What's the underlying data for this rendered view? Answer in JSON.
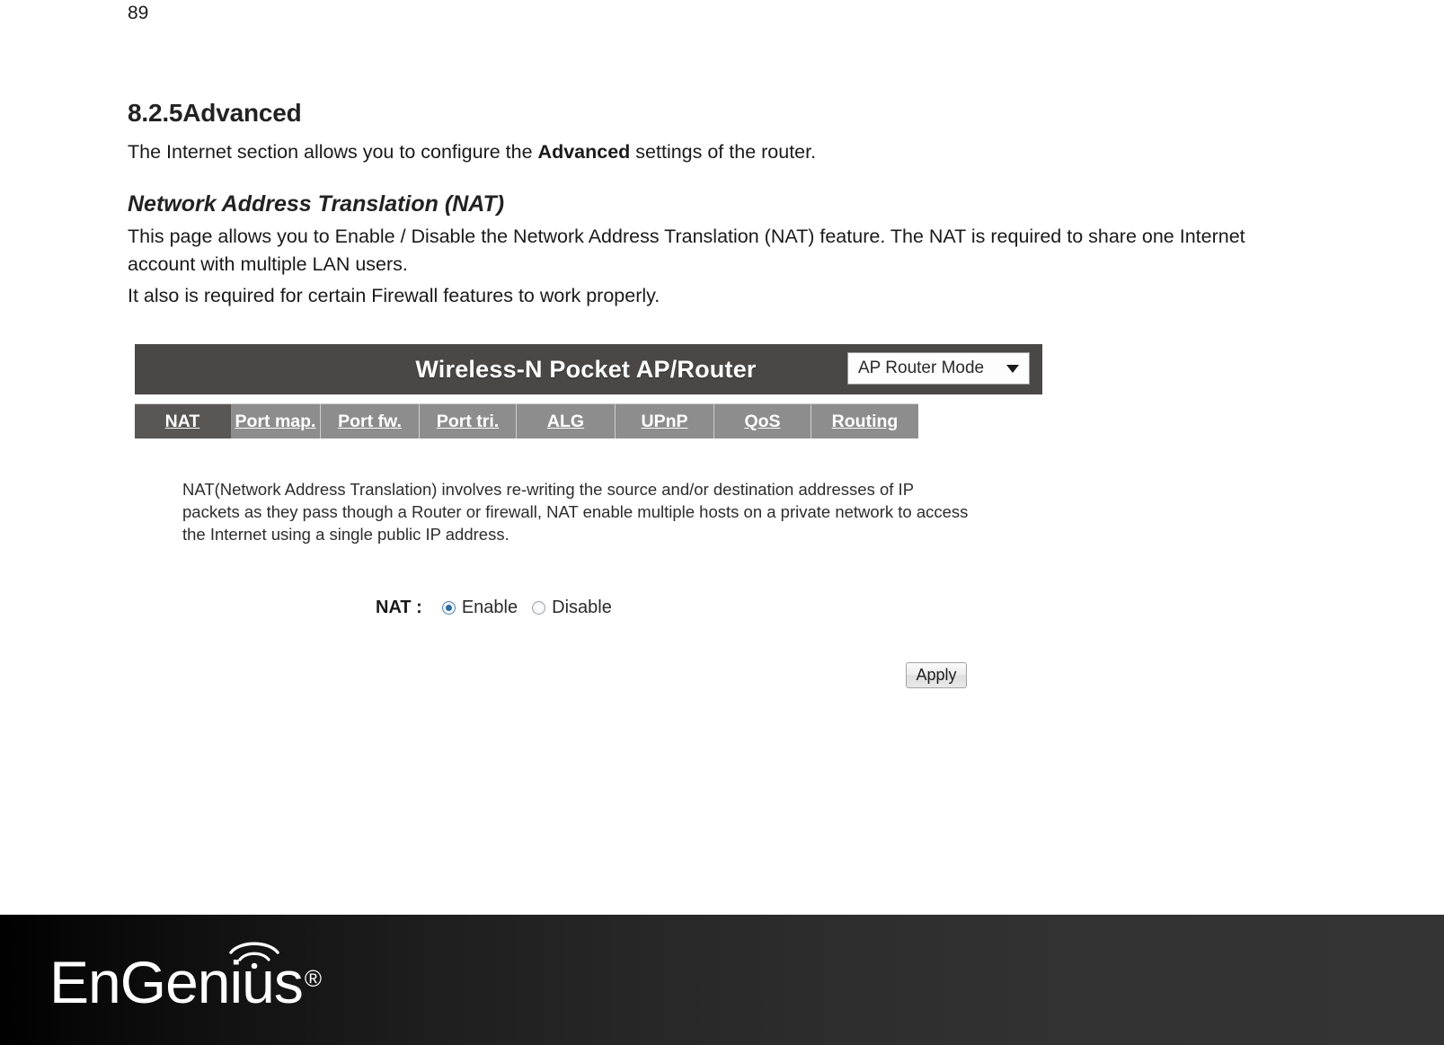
{
  "page": {
    "number": "89"
  },
  "document": {
    "section_heading": "8.2.5Advanced",
    "intro_before_bold": "The Internet section allows you to configure the ",
    "intro_bold": "Advanced",
    "intro_after_bold": " settings of the router.",
    "sub_heading": "Network Address Translation (NAT)",
    "paragraph_1": "This page allows you to Enable / Disable the Network Address Translation (NAT) feature. The NAT is required to share one Internet account with multiple LAN users.",
    "paragraph_2": "It also is required for certain Firewall features to work properly."
  },
  "router_ui": {
    "title": "Wireless-N Pocket AP/Router",
    "mode_select": {
      "value": "AP Router Mode",
      "caret_icon": "chevron-down-icon"
    },
    "tabs": [
      {
        "label": "NAT",
        "active": true
      },
      {
        "label": "Port map.",
        "active": false
      },
      {
        "label": "Port fw.",
        "active": false
      },
      {
        "label": "Port tri.",
        "active": false
      },
      {
        "label": "ALG",
        "active": false
      },
      {
        "label": "UPnP",
        "active": false
      },
      {
        "label": "QoS",
        "active": false
      },
      {
        "label": "Routing",
        "active": false
      }
    ],
    "description": "NAT(Network Address Translation) involves re-writing the source and/or destination addresses of IP packets as they pass though a Router or firewall, NAT enable multiple hosts on a private network to access the Internet using a single public IP address.",
    "nat_field": {
      "label": "NAT :",
      "options": [
        {
          "label": "Enable",
          "selected": true
        },
        {
          "label": "Disable",
          "selected": false
        }
      ]
    },
    "apply_button": "Apply"
  },
  "footer": {
    "brand": "EnGenius",
    "registered_mark": "®",
    "wifi_icon": "wifi-arc-icon"
  }
}
